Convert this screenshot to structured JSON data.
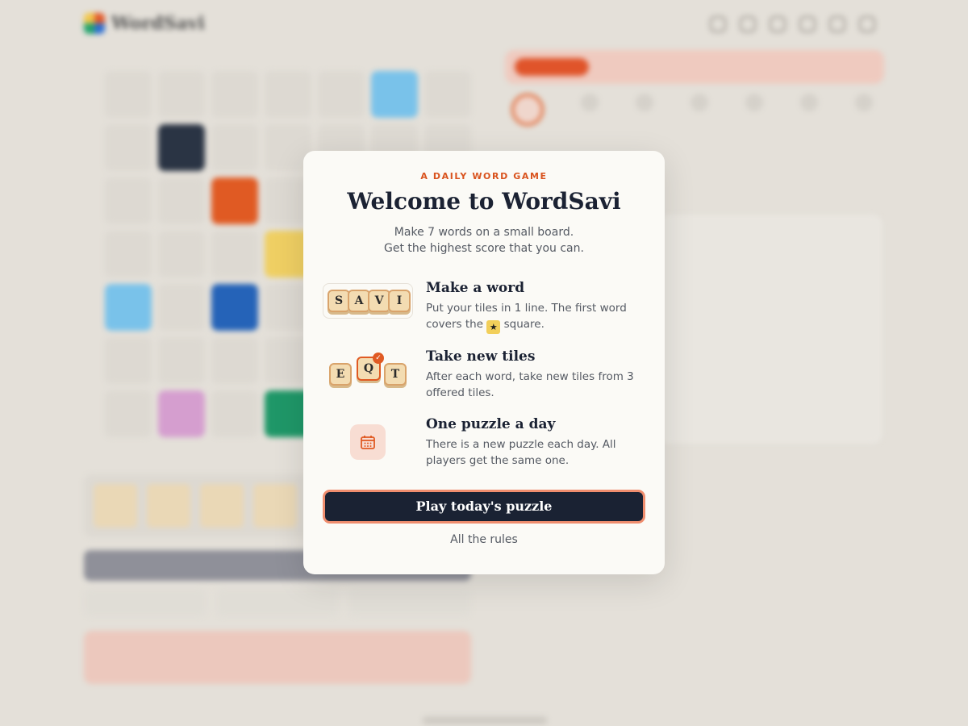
{
  "app": {
    "name": "WordSavi"
  },
  "modal": {
    "eyebrow": "A DAILY WORD GAME",
    "title": "Welcome to WordSavi",
    "subtitle_line1": "Make 7 words on a small board.",
    "subtitle_line2": "Get the highest score that you can.",
    "features": [
      {
        "title": "Make a word",
        "desc_part1": "Put your tiles in 1 line. The first word covers the",
        "desc_part2": "square.",
        "tiles": [
          "S",
          "A",
          "V",
          "I"
        ],
        "icon": "star-icon"
      },
      {
        "title": "Take new tiles",
        "desc": "After each word, take new tiles from 3 offered tiles.",
        "tiles": [
          "E",
          "Q",
          "T"
        ],
        "icon": "check-icon"
      },
      {
        "title": "One puzzle a day",
        "desc": "There is a new puzzle each day. All players get the same one.",
        "icon": "calendar-icon"
      }
    ],
    "cta_label": "Play today's puzzle",
    "rules_link": "All the rules"
  },
  "colors": {
    "accent": "#d9531e",
    "cta_bg": "#1a2233",
    "cta_border": "#ef8d6e",
    "tile_bg": "#f3dcb2",
    "star_bg": "#f2cf5a"
  }
}
